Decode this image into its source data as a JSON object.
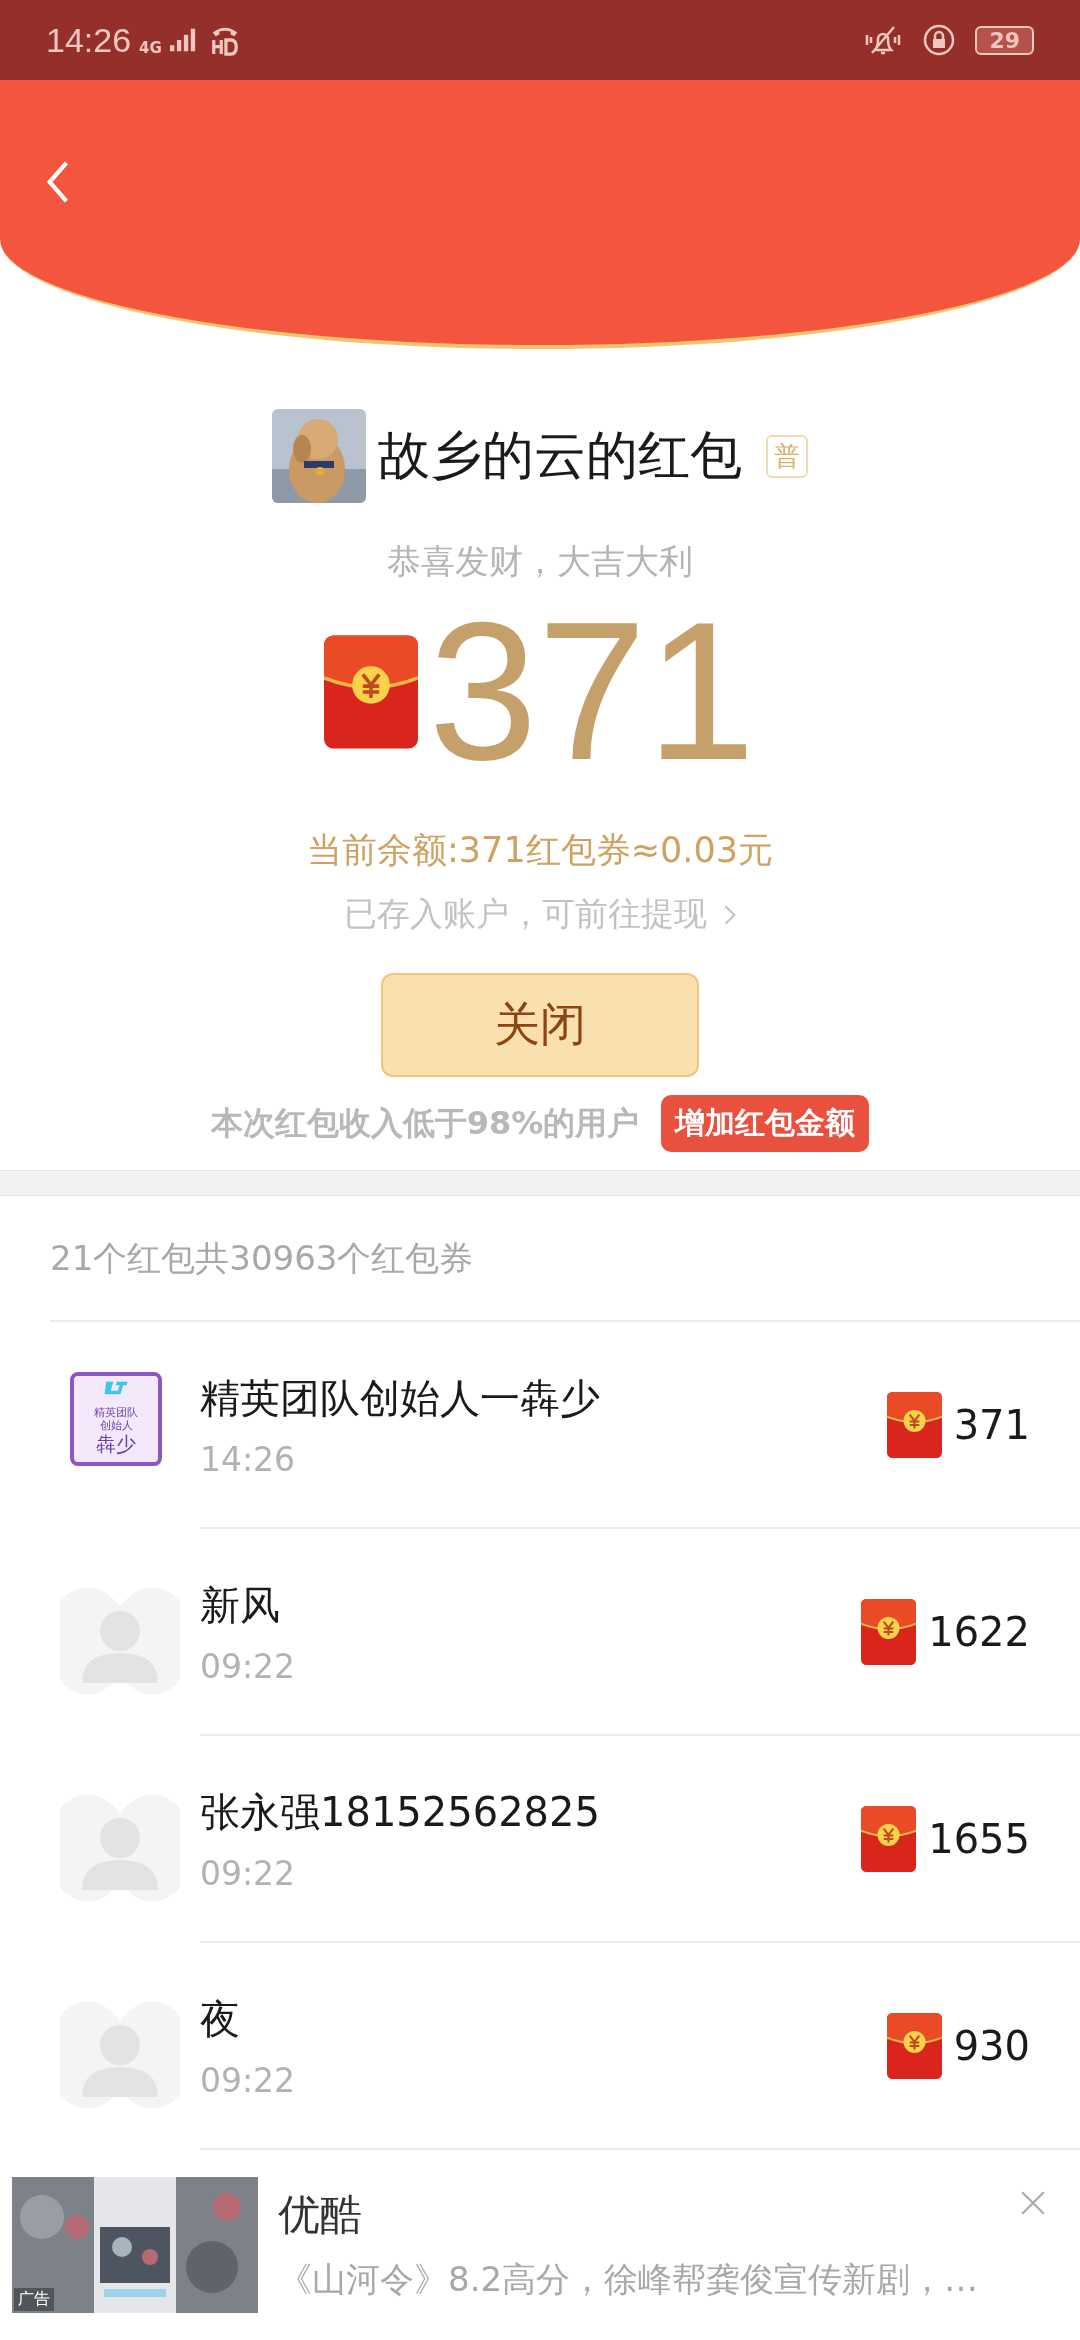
{
  "status_bar": {
    "time": "14:26",
    "network": "4G",
    "battery": "29"
  },
  "sender": {
    "title": "故乡的云的红包",
    "badge": "普",
    "greeting": "恭喜发财，大吉大利"
  },
  "amount": "371",
  "balance": "当前余额:371红包券≈0.03元",
  "deposit_link": "已存入账户，可前往提现",
  "close_button": "关闭",
  "rank": {
    "text": "本次红包收入低于98%的用户",
    "button": "增加红包金额"
  },
  "summary": "21个红包共30963个红包券",
  "receivers": [
    {
      "name": "精英团队创始人一犇少",
      "time": "14:26",
      "amount": "371",
      "kind": "badge",
      "avatar_lines": [
        "精英团队",
        "创始人",
        "犇少"
      ]
    },
    {
      "name": "新风",
      "time": "09:22",
      "amount": "1622",
      "kind": "default"
    },
    {
      "name": "张永强18152562825",
      "time": "09:22",
      "amount": "1655",
      "kind": "default"
    },
    {
      "name": "夜",
      "time": "09:22",
      "amount": "930",
      "kind": "default"
    }
  ],
  "ad": {
    "label": "广告",
    "title": "优酷",
    "text": "《山河令》8.2高分，徐峰帮龚俊宣传新剧，…"
  }
}
